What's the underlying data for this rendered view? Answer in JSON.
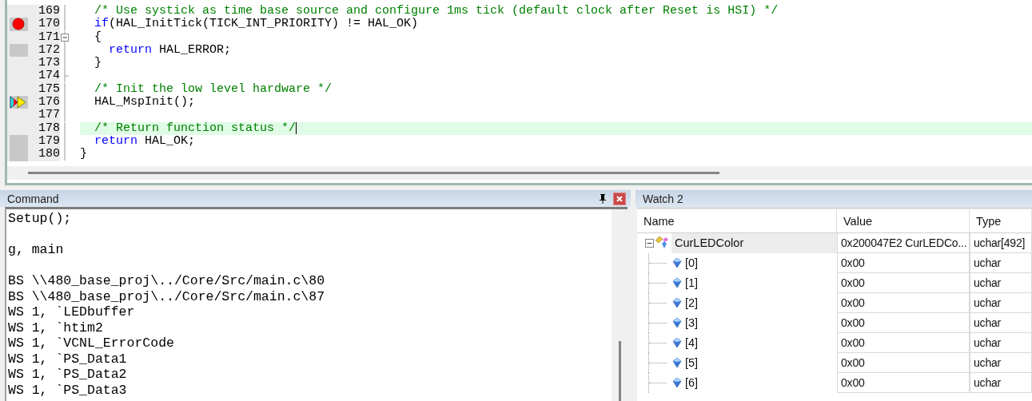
{
  "editor": {
    "lines": [
      {
        "number": "169",
        "breakpoint": false,
        "current": false,
        "covered": false,
        "fold_start": false,
        "fold_end": false,
        "current_line": false,
        "segments": [
          {
            "kind": "comment",
            "text": "  /* Use systick as time base source and configure 1ms tick (default clock after Reset is HSI) */"
          }
        ]
      },
      {
        "number": "170",
        "breakpoint": true,
        "current": false,
        "covered": true,
        "fold_start": false,
        "fold_end": false,
        "current_line": false,
        "segments": [
          {
            "kind": "keyword",
            "text": "  if"
          },
          {
            "kind": "plain",
            "text": "(HAL_InitTick(TICK_INT_PRIORITY) != HAL_OK)"
          }
        ]
      },
      {
        "number": "171",
        "breakpoint": false,
        "current": false,
        "covered": false,
        "fold_start": true,
        "fold_end": false,
        "current_line": false,
        "segments": [
          {
            "kind": "plain",
            "text": "  {"
          }
        ]
      },
      {
        "number": "172",
        "breakpoint": false,
        "current": false,
        "covered": true,
        "fold_start": false,
        "fold_end": false,
        "current_line": false,
        "segments": [
          {
            "kind": "keyword",
            "text": "    return"
          },
          {
            "kind": "plain",
            "text": " HAL_ERROR;"
          }
        ]
      },
      {
        "number": "173",
        "breakpoint": false,
        "current": false,
        "covered": false,
        "fold_start": false,
        "fold_end": false,
        "current_line": false,
        "segments": [
          {
            "kind": "plain",
            "text": "  }"
          }
        ]
      },
      {
        "number": "174",
        "breakpoint": false,
        "current": false,
        "covered": false,
        "fold_start": false,
        "fold_end": true,
        "current_line": false
      },
      {
        "number": "175",
        "breakpoint": false,
        "current": false,
        "covered": false,
        "fold_start": false,
        "fold_end": false,
        "current_line": false,
        "segments": [
          {
            "kind": "comment",
            "text": "  /* Init the low level hardware */"
          }
        ]
      },
      {
        "number": "176",
        "breakpoint": false,
        "current": true,
        "covered": true,
        "fold_start": false,
        "fold_end": false,
        "current_line": false,
        "segments": [
          {
            "kind": "plain",
            "text": "  HAL_MspInit();"
          }
        ]
      },
      {
        "number": "177",
        "breakpoint": false,
        "current": false,
        "covered": false,
        "fold_start": false,
        "fold_end": false,
        "current_line": false
      },
      {
        "number": "178",
        "breakpoint": false,
        "current": false,
        "covered": false,
        "fold_start": false,
        "fold_end": false,
        "current_line": true,
        "segments": [
          {
            "kind": "comment",
            "text": "  /* Return function status */"
          }
        ]
      },
      {
        "number": "179",
        "breakpoint": false,
        "current": false,
        "covered": true,
        "fold_start": false,
        "fold_end": false,
        "current_line": false,
        "segments": [
          {
            "kind": "keyword",
            "text": "  return"
          },
          {
            "kind": "plain",
            "text": " HAL_OK;"
          }
        ]
      },
      {
        "number": "180",
        "breakpoint": false,
        "current": false,
        "covered": true,
        "fold_start": false,
        "fold_end": false,
        "current_line": false,
        "segments": [
          {
            "kind": "plain",
            "text": "}"
          }
        ]
      }
    ]
  },
  "command": {
    "title": "Command",
    "blocks": [
      [
        "Setup();"
      ],
      [
        "g, main"
      ],
      [
        "BS \\\\480_base_proj\\../Core/Src/main.c\\80",
        "BS \\\\480_base_proj\\../Core/Src/main.c\\87",
        "WS 1, `LEDbuffer",
        "WS 1, `htim2",
        "WS 1, `VCNL_ErrorCode",
        "WS 1, `PS_Data1",
        "WS 1, `PS_Data2",
        "WS 1, `PS_Data3"
      ]
    ]
  },
  "watch": {
    "title": "Watch 2",
    "columns": [
      "Name",
      "Value",
      "Type"
    ],
    "rows": [
      {
        "name": "CurLEDColor",
        "value": "0x200047E2 CurLEDCo...",
        "type": "uchar[492]",
        "selected": true,
        "expanded": true,
        "children": [
          {
            "name": "[0]",
            "value": "0x00",
            "type": "uchar",
            "selected": false
          },
          {
            "name": "[1]",
            "value": "0x00",
            "type": "uchar",
            "selected": false
          },
          {
            "name": "[2]",
            "value": "0x00",
            "type": "uchar",
            "selected": false
          },
          {
            "name": "[3]",
            "value": "0x00",
            "type": "uchar",
            "selected": false
          },
          {
            "name": "[4]",
            "value": "0x00",
            "type": "uchar",
            "selected": false
          },
          {
            "name": "[5]",
            "value": "0x00",
            "type": "uchar",
            "selected": false
          },
          {
            "name": "[6]",
            "value": "0x00",
            "type": "uchar",
            "selected": false
          }
        ]
      }
    ]
  }
}
